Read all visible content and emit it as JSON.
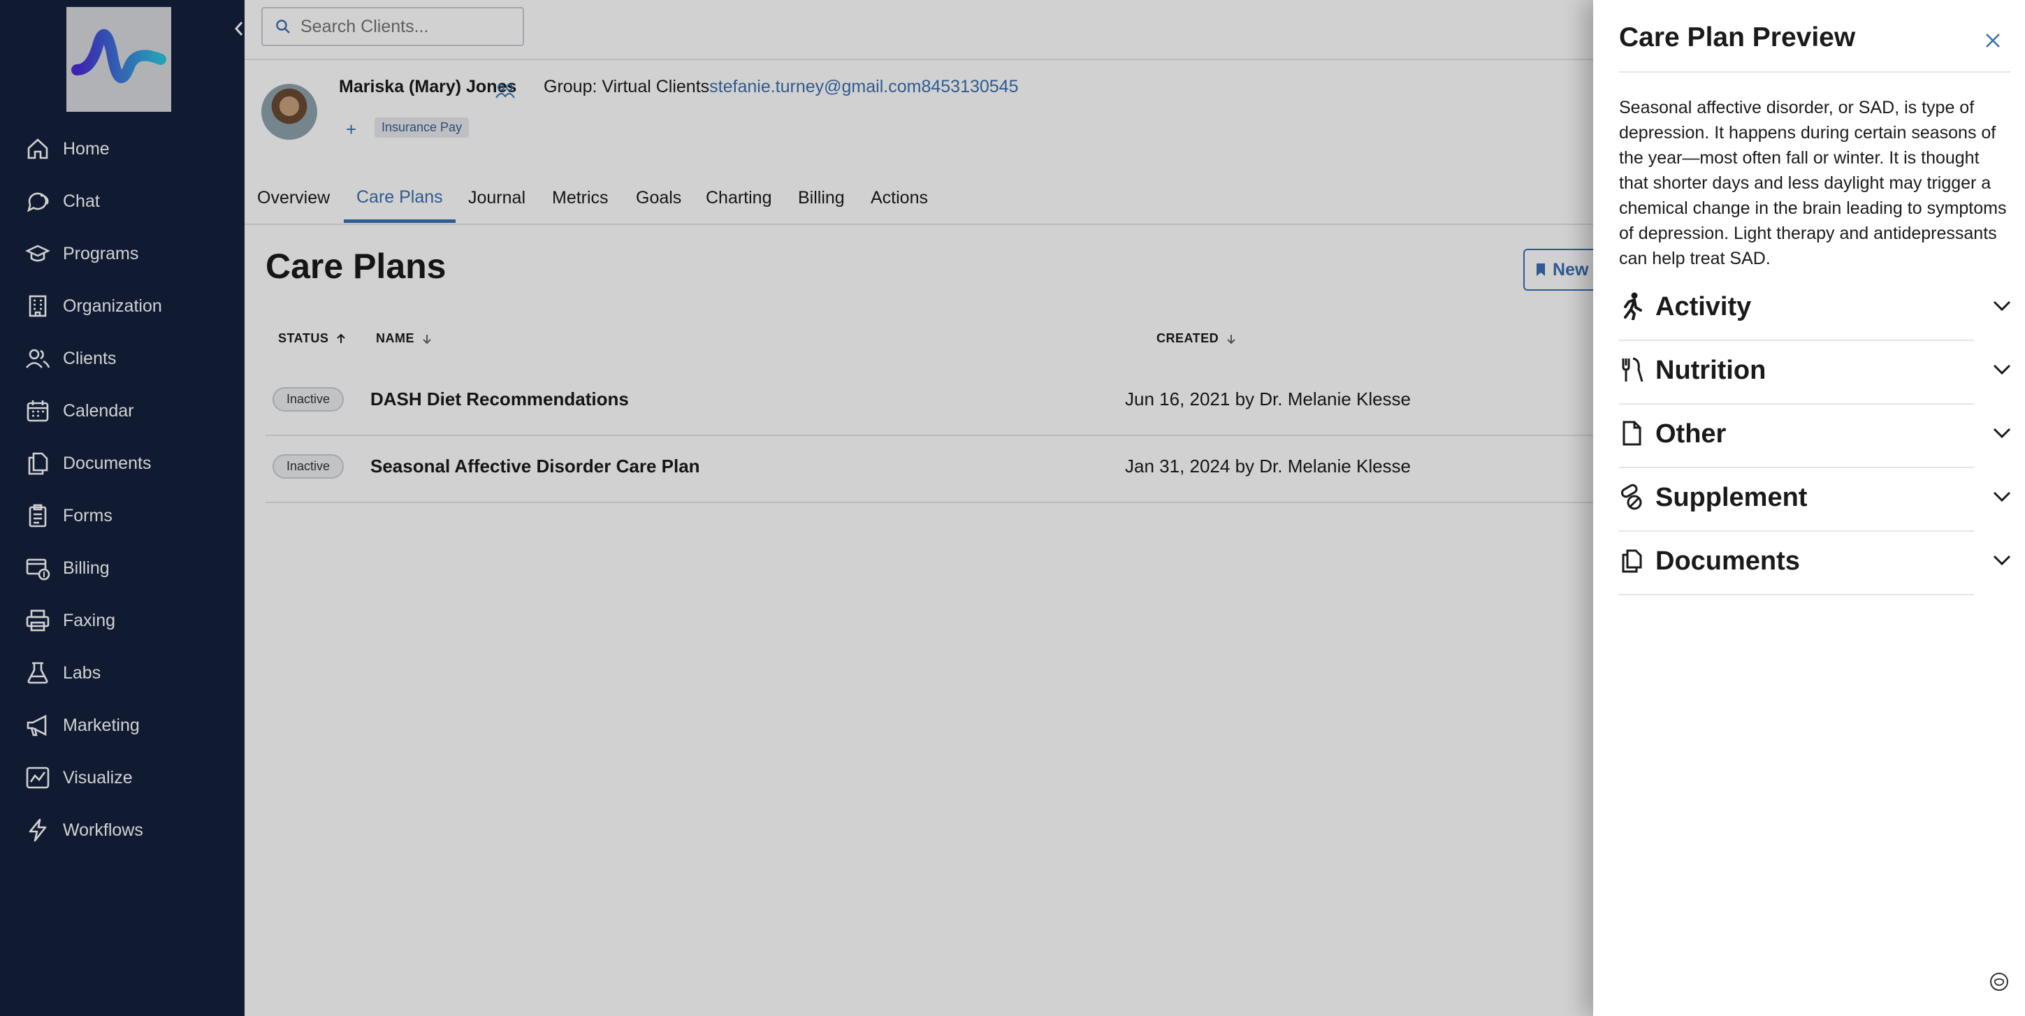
{
  "colors": {
    "sidebar_bg": "#14213d",
    "accent": "#3a6fb0",
    "logo_gradient": [
      "#4b2bd6",
      "#2ec4e0"
    ]
  },
  "sidebar": {
    "items": [
      {
        "label": "Home",
        "icon": "home-icon"
      },
      {
        "label": "Chat",
        "icon": "chat-icon"
      },
      {
        "label": "Programs",
        "icon": "programs-icon"
      },
      {
        "label": "Organization",
        "icon": "organization-icon"
      },
      {
        "label": "Clients",
        "icon": "clients-icon"
      },
      {
        "label": "Calendar",
        "icon": "calendar-icon"
      },
      {
        "label": "Documents",
        "icon": "documents-icon"
      },
      {
        "label": "Forms",
        "icon": "forms-icon"
      },
      {
        "label": "Billing",
        "icon": "billing-icon"
      },
      {
        "label": "Faxing",
        "icon": "printer-icon"
      },
      {
        "label": "Labs",
        "icon": "labs-icon"
      },
      {
        "label": "Marketing",
        "icon": "megaphone-icon"
      },
      {
        "label": "Visualize",
        "icon": "chart-icon"
      },
      {
        "label": "Workflows",
        "icon": "bolt-icon"
      }
    ]
  },
  "search": {
    "placeholder": "Search Clients..."
  },
  "client": {
    "name": "Mariska (Mary) Jones",
    "group_label": "Group: Virtual Clients",
    "email": "stefanie.turney@gmail.com",
    "phone": "8453130545",
    "add_tag": "+",
    "payment_badge": "Insurance Pay"
  },
  "tabs": [
    {
      "label": "Overview",
      "active": false
    },
    {
      "label": "Care Plans",
      "active": true
    },
    {
      "label": "Journal",
      "active": false
    },
    {
      "label": "Metrics",
      "active": false
    },
    {
      "label": "Goals",
      "active": false
    },
    {
      "label": "Charting",
      "active": false
    },
    {
      "label": "Billing",
      "active": false
    },
    {
      "label": "Actions",
      "active": false
    }
  ],
  "page": {
    "title": "Care Plans",
    "new_button": "New"
  },
  "table": {
    "headers": {
      "status": "STATUS",
      "name": "NAME",
      "created": "CREATED"
    },
    "rows": [
      {
        "status": "Inactive",
        "name": "DASH Diet Recommendations",
        "created": "Jun 16, 2021 by Dr. Melanie Klesse"
      },
      {
        "status": "Inactive",
        "name": "Seasonal Affective Disorder Care Plan",
        "created": "Jan 31, 2024 by Dr. Melanie Klesse"
      }
    ]
  },
  "drawer": {
    "title": "Care Plan Preview",
    "description": "Seasonal affective disorder, or SAD, is type of depression. It happens during certain seasons of the year—most often fall or winter. It is thought that shorter days and less daylight may trigger a chemical change in the brain leading to symptoms of depression. Light therapy and antidepressants can help treat SAD.",
    "sections": [
      {
        "label": "Activity",
        "icon": "running-icon"
      },
      {
        "label": "Nutrition",
        "icon": "utensils-icon"
      },
      {
        "label": "Other",
        "icon": "file-icon"
      },
      {
        "label": "Supplement",
        "icon": "pills-icon"
      },
      {
        "label": "Documents",
        "icon": "copy-icon"
      }
    ]
  }
}
